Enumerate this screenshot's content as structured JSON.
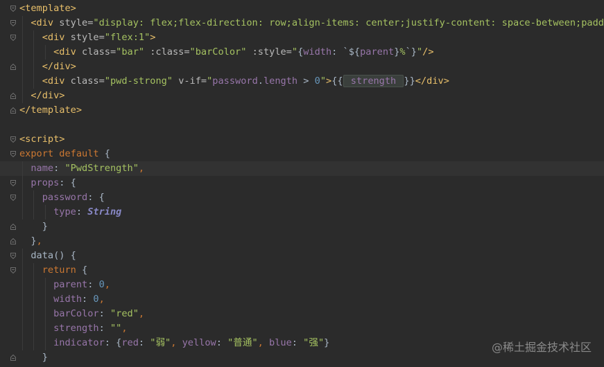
{
  "editor": {
    "lines": [
      [
        {
          "c": "t-tag",
          "t": "<template>"
        }
      ],
      [
        {
          "c": "t-plain",
          "t": "  "
        },
        {
          "c": "t-tag",
          "t": "<div "
        },
        {
          "c": "t-attr",
          "t": "style="
        },
        {
          "c": "t-str",
          "t": "\"display: flex;flex-direction: row;align-items: center;justify-content: space-between;padding"
        }
      ],
      [
        {
          "c": "t-plain",
          "t": "    "
        },
        {
          "c": "t-tag",
          "t": "<div "
        },
        {
          "c": "t-attr",
          "t": "style="
        },
        {
          "c": "t-str",
          "t": "\"flex:1\""
        },
        {
          "c": "t-tag",
          "t": ">"
        }
      ],
      [
        {
          "c": "t-plain",
          "t": "      "
        },
        {
          "c": "t-tag",
          "t": "<div "
        },
        {
          "c": "t-attr",
          "t": "class="
        },
        {
          "c": "t-str",
          "t": "\"bar\" "
        },
        {
          "c": "t-attr",
          "t": ":class="
        },
        {
          "c": "t-str",
          "t": "\"barColor\" "
        },
        {
          "c": "t-attr",
          "t": ":style="
        },
        {
          "c": "t-str",
          "t": "\""
        },
        {
          "c": "t-plain",
          "t": "{"
        },
        {
          "c": "t-prop",
          "t": "width"
        },
        {
          "c": "t-plain",
          "t": ": `${"
        },
        {
          "c": "t-prop",
          "t": "parent"
        },
        {
          "c": "t-plain",
          "t": "}"
        },
        {
          "c": "t-str",
          "t": "%"
        },
        {
          "c": "t-plain",
          "t": "`}"
        },
        {
          "c": "t-str",
          "t": "\""
        },
        {
          "c": "t-tag",
          "t": "/>"
        }
      ],
      [
        {
          "c": "t-plain",
          "t": "    "
        },
        {
          "c": "t-tag",
          "t": "</div>"
        }
      ],
      [
        {
          "c": "t-plain",
          "t": "    "
        },
        {
          "c": "t-tag",
          "t": "<div "
        },
        {
          "c": "t-attr",
          "t": "class="
        },
        {
          "c": "t-str",
          "t": "\"pwd-strong\" "
        },
        {
          "c": "t-attr",
          "t": "v-if="
        },
        {
          "c": "t-str",
          "t": "\""
        },
        {
          "c": "t-prop",
          "t": "password"
        },
        {
          "c": "t-plain",
          "t": "."
        },
        {
          "c": "t-prop",
          "t": "length"
        },
        {
          "c": "t-plain",
          "t": " > "
        },
        {
          "c": "t-num",
          "t": "0"
        },
        {
          "c": "t-str",
          "t": "\""
        },
        {
          "c": "t-tag",
          "t": ">"
        },
        {
          "c": "t-interp",
          "t": "{{"
        },
        {
          "c": "t-prop hl-box",
          "t": " strength "
        },
        {
          "c": "t-interp",
          "t": "}}"
        },
        {
          "c": "t-tag",
          "t": "</div>"
        }
      ],
      [
        {
          "c": "t-plain",
          "t": "  "
        },
        {
          "c": "t-tag",
          "t": "</div>"
        }
      ],
      [
        {
          "c": "t-tag",
          "t": "</template>"
        }
      ],
      [],
      [
        {
          "c": "t-tag",
          "t": "<script>"
        }
      ],
      [
        {
          "c": "t-kw",
          "t": "export default "
        },
        {
          "c": "t-plain",
          "t": "{"
        }
      ],
      [
        {
          "c": "t-plain",
          "t": "  "
        },
        {
          "c": "t-prop",
          "t": "name"
        },
        {
          "c": "t-plain",
          "t": ": "
        },
        {
          "c": "t-str",
          "t": "\"PwdStrength\""
        },
        {
          "c": "t-kw",
          "t": ","
        }
      ],
      [
        {
          "c": "t-plain",
          "t": "  "
        },
        {
          "c": "t-prop",
          "t": "props"
        },
        {
          "c": "t-plain",
          "t": ": {"
        }
      ],
      [
        {
          "c": "t-plain",
          "t": "    "
        },
        {
          "c": "t-prop",
          "t": "password"
        },
        {
          "c": "t-plain",
          "t": ": {"
        }
      ],
      [
        {
          "c": "t-plain",
          "t": "      "
        },
        {
          "c": "t-prop",
          "t": "type"
        },
        {
          "c": "t-plain",
          "t": ": "
        },
        {
          "c": "t-type",
          "t": "String"
        }
      ],
      [
        {
          "c": "t-plain",
          "t": "    }"
        }
      ],
      [
        {
          "c": "t-plain",
          "t": "  }"
        },
        {
          "c": "t-kw",
          "t": ","
        }
      ],
      [
        {
          "c": "t-plain",
          "t": "  "
        },
        {
          "c": "t-plain",
          "t": "data() {"
        }
      ],
      [
        {
          "c": "t-plain",
          "t": "    "
        },
        {
          "c": "t-kw",
          "t": "return "
        },
        {
          "c": "t-plain",
          "t": "{"
        }
      ],
      [
        {
          "c": "t-plain",
          "t": "      "
        },
        {
          "c": "t-prop",
          "t": "parent"
        },
        {
          "c": "t-plain",
          "t": ": "
        },
        {
          "c": "t-num",
          "t": "0"
        },
        {
          "c": "t-kw",
          "t": ","
        }
      ],
      [
        {
          "c": "t-plain",
          "t": "      "
        },
        {
          "c": "t-prop",
          "t": "width"
        },
        {
          "c": "t-plain",
          "t": ": "
        },
        {
          "c": "t-num",
          "t": "0"
        },
        {
          "c": "t-kw",
          "t": ","
        }
      ],
      [
        {
          "c": "t-plain",
          "t": "      "
        },
        {
          "c": "t-prop",
          "t": "barColor"
        },
        {
          "c": "t-plain",
          "t": ": "
        },
        {
          "c": "t-str",
          "t": "\"red\""
        },
        {
          "c": "t-kw",
          "t": ","
        }
      ],
      [
        {
          "c": "t-plain",
          "t": "      "
        },
        {
          "c": "t-prop",
          "t": "strength"
        },
        {
          "c": "t-plain",
          "t": ": "
        },
        {
          "c": "t-str",
          "t": "\"\""
        },
        {
          "c": "t-kw",
          "t": ","
        }
      ],
      [
        {
          "c": "t-plain",
          "t": "      "
        },
        {
          "c": "t-prop",
          "t": "indicator"
        },
        {
          "c": "t-plain",
          "t": ": {"
        },
        {
          "c": "t-prop",
          "t": "red"
        },
        {
          "c": "t-plain",
          "t": ": "
        },
        {
          "c": "t-str",
          "t": "\"弱\""
        },
        {
          "c": "t-kw",
          "t": ", "
        },
        {
          "c": "t-prop",
          "t": "yellow"
        },
        {
          "c": "t-plain",
          "t": ": "
        },
        {
          "c": "t-str",
          "t": "\"普通\""
        },
        {
          "c": "t-kw",
          "t": ", "
        },
        {
          "c": "t-prop",
          "t": "blue"
        },
        {
          "c": "t-plain",
          "t": ": "
        },
        {
          "c": "t-str",
          "t": "\"强\""
        },
        {
          "c": "t-plain",
          "t": "}"
        }
      ],
      [
        {
          "c": "t-plain",
          "t": "    }"
        }
      ]
    ],
    "fold_markers": [
      "fold-open",
      "fold-open",
      "fold-open",
      "none",
      "fold-close",
      "none",
      "fold-close",
      "fold-close",
      "none",
      "fold-open",
      "fold-open",
      "none",
      "fold-open",
      "fold-open",
      "none",
      "fold-close",
      "fold-close",
      "fold-open",
      "fold-open",
      "none",
      "none",
      "none",
      "none",
      "none",
      "fold-close"
    ],
    "current_line": 11
  },
  "watermark": "@稀土掘金技术社区",
  "colors": {
    "background": "#2b2b2b",
    "tag": "#e8bf6a",
    "string": "#a5c261",
    "keyword": "#cc7832",
    "property": "#9876aa",
    "number": "#6897bb"
  }
}
